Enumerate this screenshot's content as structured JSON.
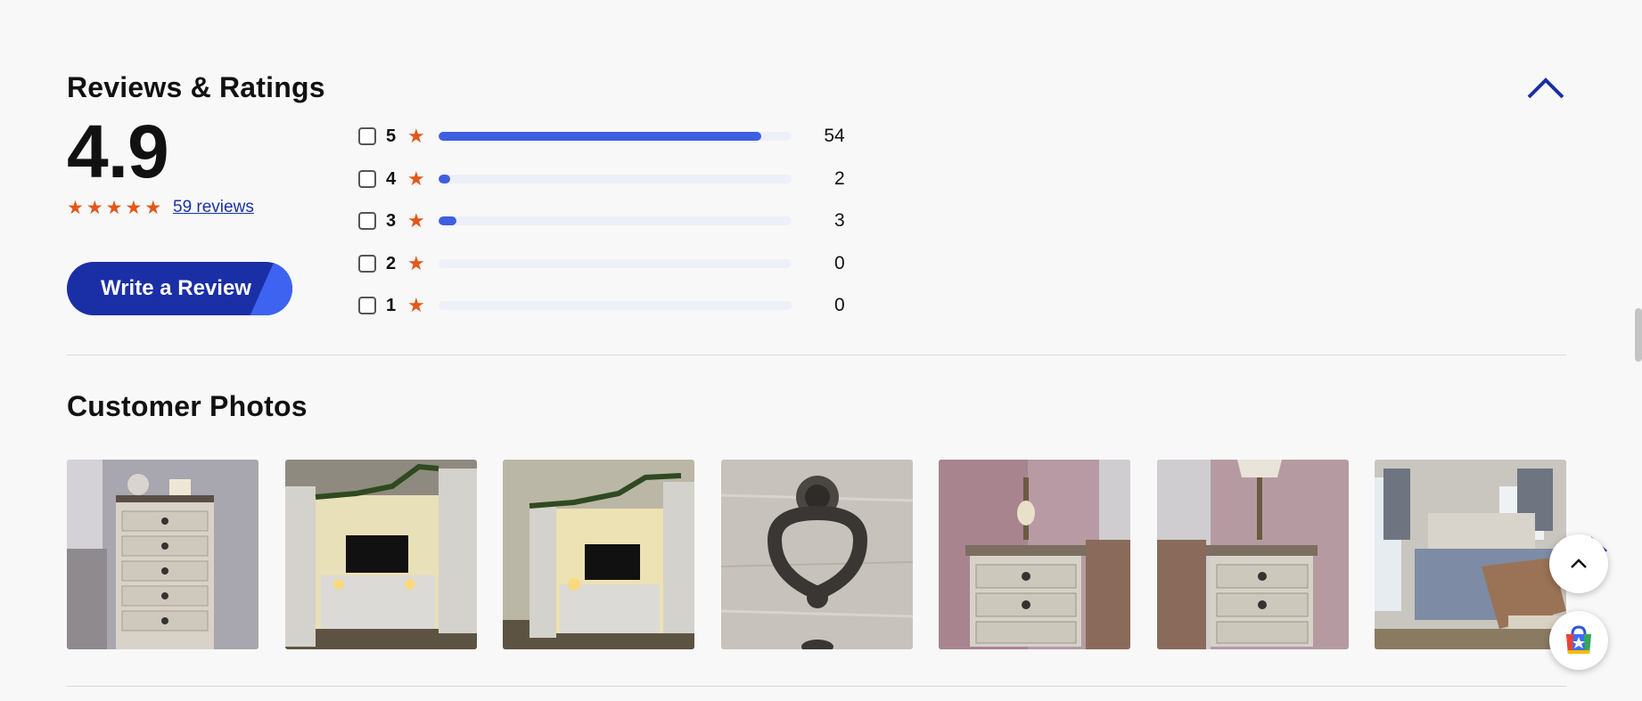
{
  "reviews": {
    "title": "Reviews & Ratings",
    "average": "4.9",
    "reviews_link": "59 reviews",
    "stars_filled": 5,
    "write_review_label": "Write a Review",
    "breakdown": [
      {
        "stars": "5",
        "count": "54",
        "fraction": 0.915
      },
      {
        "stars": "4",
        "count": "2",
        "fraction": 0.034
      },
      {
        "stars": "3",
        "count": "3",
        "fraction": 0.051
      },
      {
        "stars": "2",
        "count": "0",
        "fraction": 0
      },
      {
        "stars": "1",
        "count": "0",
        "fraction": 0
      }
    ]
  },
  "photos": {
    "title": "Customer Photos",
    "items": [
      "tall-dresser",
      "entertainment-center",
      "entertainment-center",
      "drawer-pull",
      "nightstand",
      "nightstand",
      "bedroom"
    ]
  },
  "colors": {
    "accent": "#1a2fa6",
    "bar": "#3d5fe0",
    "star": "#e2571a",
    "link": "#1a32a8"
  },
  "icons": {
    "collapse": "chevron-up-icon",
    "scroll_top": "chevron-up-icon",
    "carousel_next": "chevron-right-icon",
    "shopping": "shopping-bag-icon"
  }
}
